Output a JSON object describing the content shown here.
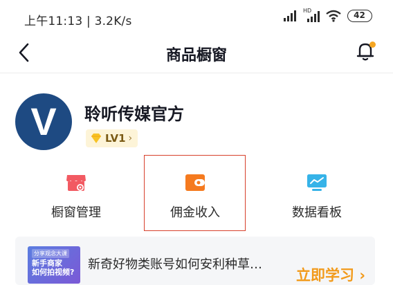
{
  "status_bar": {
    "time": "上午11:13",
    "speed": "3.2K/s",
    "hd_label": "HD",
    "battery": "42"
  },
  "header": {
    "title": "商品橱窗"
  },
  "profile": {
    "avatar_letter": "V",
    "name": "聆听传媒官方",
    "level": "LV1",
    "level_chevron": "›"
  },
  "features": [
    {
      "label": "橱窗管理",
      "icon": "shop-icon",
      "color": "#f25a62"
    },
    {
      "label": "佣金收入",
      "icon": "wallet-icon",
      "color": "#f57a1f"
    },
    {
      "label": "数据看板",
      "icon": "monitor-chart-icon",
      "color": "#36b3e8"
    }
  ],
  "banner": {
    "thumb_tag": "分享观念大课",
    "thumb_line1": "新手商家",
    "thumb_line2": "如何拍视频?",
    "text": "新奇好物类账号如何安利种草…",
    "link": "立即学习 ›"
  },
  "colors": {
    "accent_orange": "#f29a1a",
    "badge_bg": "#fdf4d8",
    "highlight_red": "#d7402b",
    "avatar_blue": "#1e4a82"
  }
}
